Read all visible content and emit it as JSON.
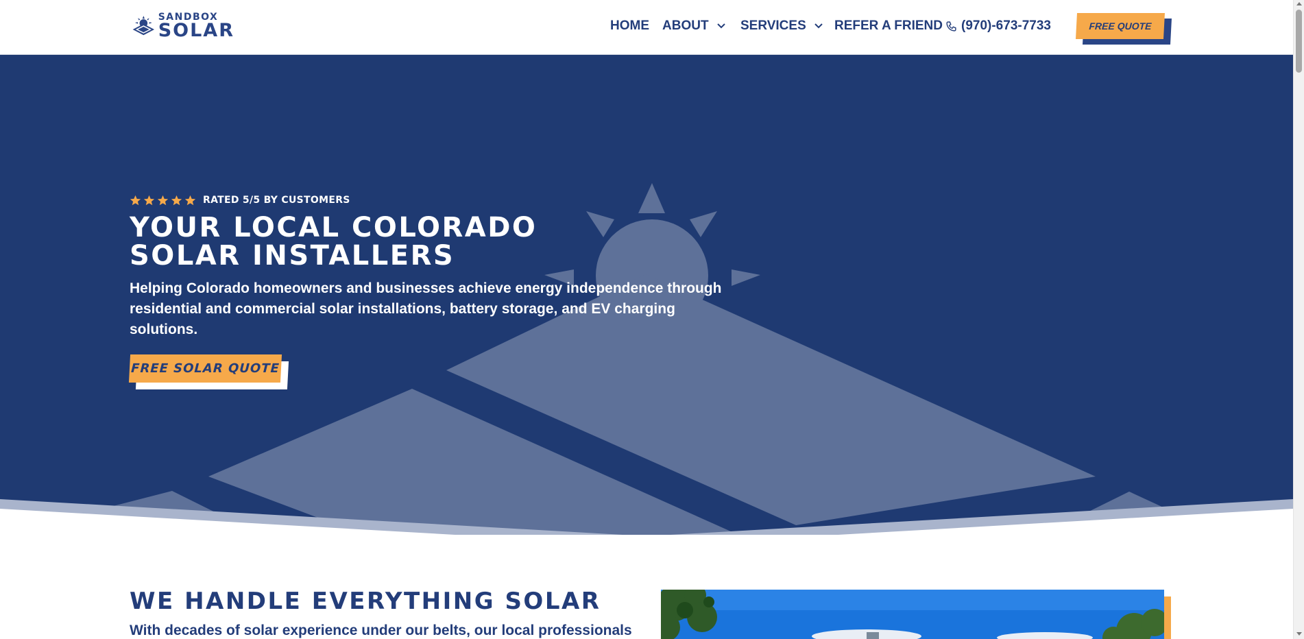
{
  "brand": {
    "name_top": "SANDBOX",
    "name_bottom": "SOLAR"
  },
  "nav": {
    "home": "HOME",
    "about": "ABOUT",
    "services": "SERVICES",
    "refer": "REFER A FRIEND",
    "phone": "(970)-673-7733",
    "quote": "FREE QUOTE"
  },
  "hero": {
    "rating_stars": 5,
    "rating_text": "RATED 5/5 BY CUSTOMERS",
    "title": "YOUR LOCAL COLORADO SOLAR INSTALLERS",
    "subtitle": "Helping Colorado homeowners and businesses achieve energy independence through residential and commercial solar installations, battery storage, and EV charging solutions.",
    "cta": "FREE SOLAR QUOTE"
  },
  "section": {
    "title": "WE HANDLE EVERYTHING SOLAR",
    "text": "With decades of solar experience under our belts, our local professionals"
  },
  "colors": {
    "navy": "#1f3a72",
    "brand_blue": "#233d7a",
    "orange": "#f6a94a",
    "white": "#ffffff"
  },
  "icons": [
    "sun-logo-icon",
    "chevron-down-icon",
    "phone-icon",
    "star-icon"
  ]
}
